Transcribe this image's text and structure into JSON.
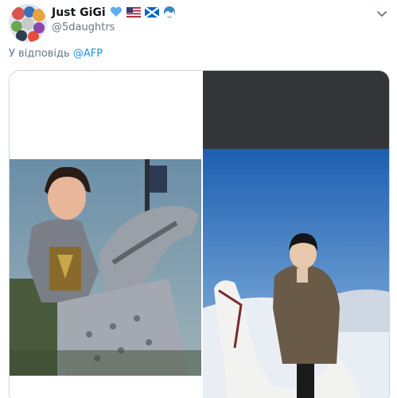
{
  "author": {
    "display_name": "Just GiGi",
    "handle": "@5daughtrs",
    "name_emojis": [
      "blue-heart",
      "us-flag",
      "scotland-flag",
      "wave"
    ]
  },
  "reply": {
    "prefix": "У відповідь",
    "mention": "@AFP"
  },
  "media": {
    "images": [
      {
        "name": "animated-knight-on-armored-horse-photo"
      },
      {
        "name": "leader-on-white-horse-in-snow-photo"
      }
    ]
  },
  "colors": {
    "text": "#14171a",
    "secondary": "#657786",
    "link": "#1b95e0",
    "border": "#ccd6dd",
    "dark_band": "#333538"
  }
}
